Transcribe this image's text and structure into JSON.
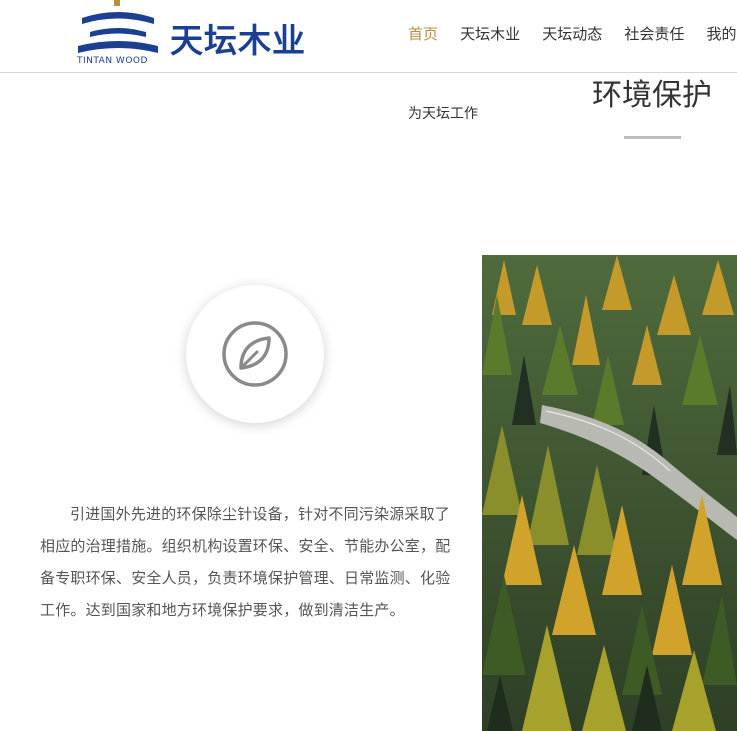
{
  "header": {
    "logo_cn": "天坛木业",
    "logo_en": "TINTAN WOOD",
    "nav": [
      {
        "label": "首页",
        "active": true
      },
      {
        "label": "天坛木业",
        "active": false
      },
      {
        "label": "天坛动态",
        "active": false
      },
      {
        "label": "社会责任",
        "active": false
      },
      {
        "label": "我的天坛",
        "active": false
      }
    ]
  },
  "sub_link": "为天坛工作",
  "section": {
    "title": "环境保护",
    "icon": "leaf-icon",
    "description": "引进国外先进的环保除尘针设备，针对不同污染源采取了相应的治理措施。组织机构设置环保、安全、节能办公室，配备专职环保、安全人员，负责环境保护管理、日常监测、化验工作。达到国家和地方环境保护要求，做到清洁生产。"
  },
  "colors": {
    "brand_blue": "#1b3f93",
    "accent_gold": "#b8913f",
    "divider": "#bdbdbd"
  }
}
